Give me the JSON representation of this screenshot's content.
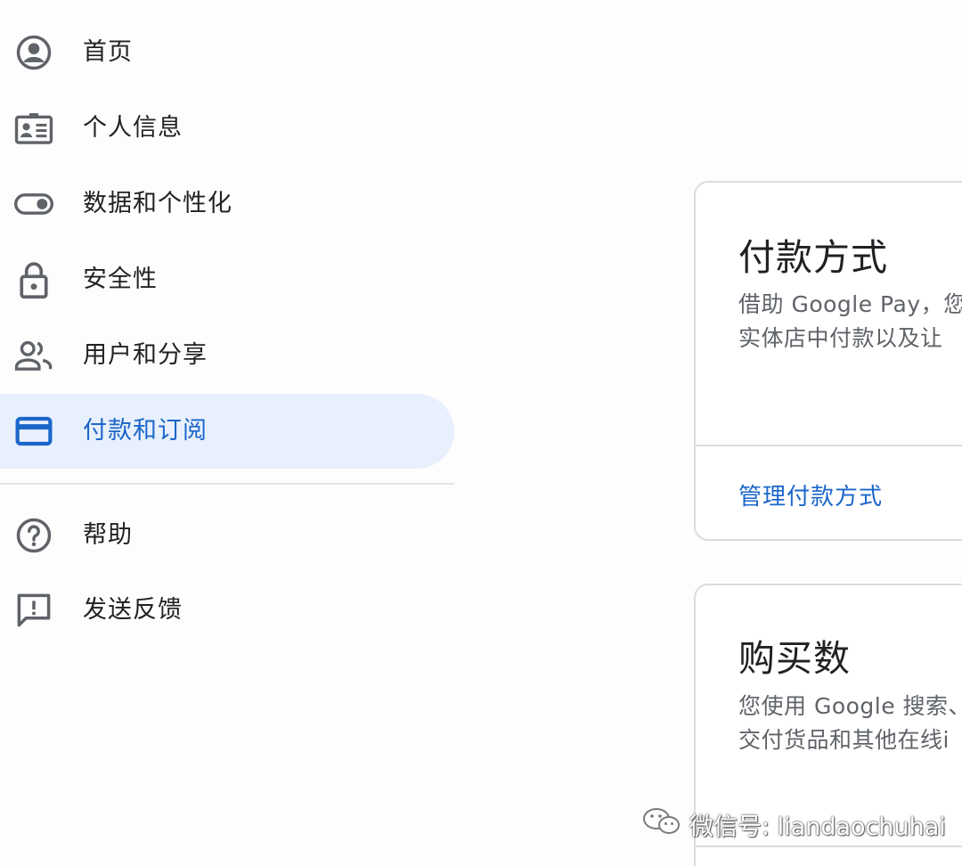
{
  "sidebar": {
    "items": [
      {
        "label": "首页",
        "icon": "account-circle-icon"
      },
      {
        "label": "个人信息",
        "icon": "id-card-icon"
      },
      {
        "label": "数据和个性化",
        "icon": "toggle-icon"
      },
      {
        "label": "安全性",
        "icon": "lock-icon"
      },
      {
        "label": "用户和分享",
        "icon": "people-icon"
      },
      {
        "label": "付款和订阅",
        "icon": "credit-card-icon",
        "active": true
      },
      {
        "label": "帮助",
        "icon": "help-circle-icon"
      },
      {
        "label": "发送反馈",
        "icon": "feedback-icon"
      }
    ]
  },
  "cards": [
    {
      "title": "付款方式",
      "description_lines": [
        "借助 Google Pay，您",
        "实体店中付款以及让"
      ],
      "link": "管理付款方式"
    },
    {
      "title": "购买数",
      "description_lines": [
        "您使用 Google 搜索、",
        "交付货品和其他在线i"
      ]
    }
  ],
  "watermark": {
    "text": "微信号: liandaochuhai",
    "icon": "wechat-icon"
  },
  "colors": {
    "accent": "#1a66c9",
    "active_bg": "#e8f0fd",
    "icon_gray": "#5f6368",
    "text": "#202124"
  }
}
